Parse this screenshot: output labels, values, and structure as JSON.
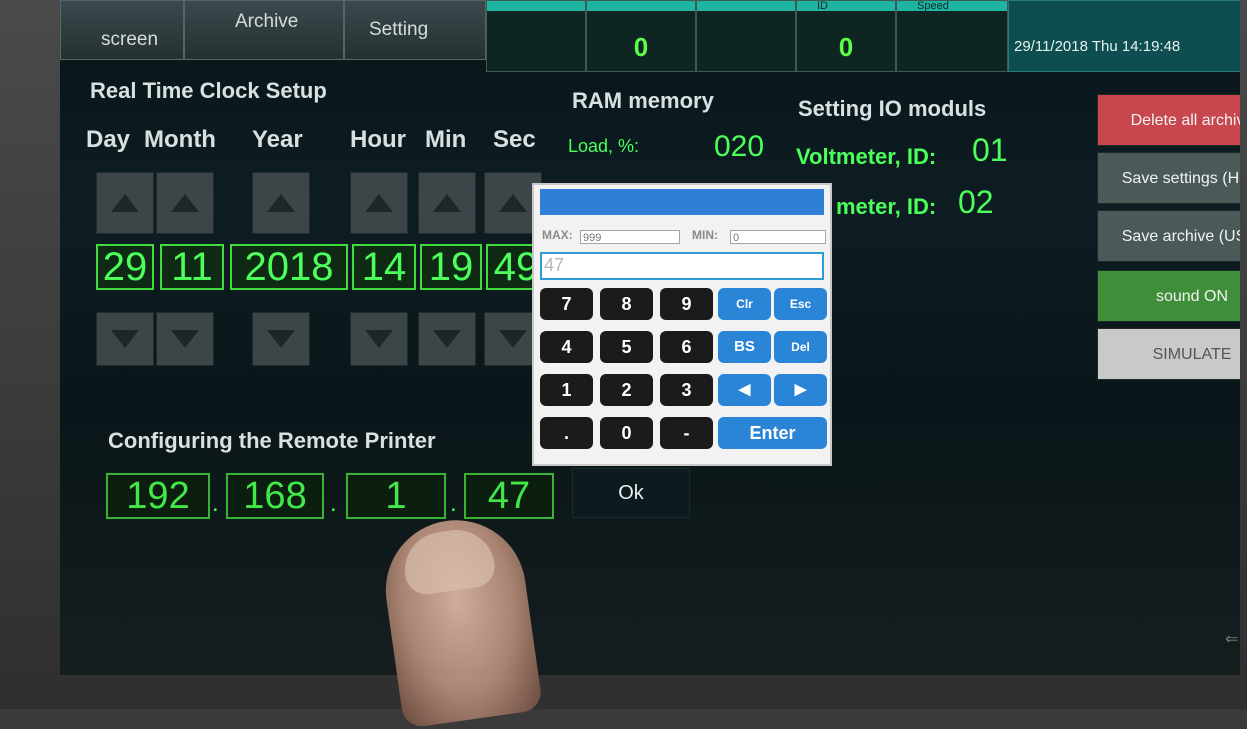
{
  "nav": {
    "screen_label": "screen",
    "archive_label": "Archive",
    "setting_label": "Setting"
  },
  "header": {
    "cells": [
      {
        "value": "0"
      },
      {
        "value": "0"
      }
    ],
    "id_label": "ID",
    "speed_label": "Speed",
    "datetime": "29/11/2018 Thu  14:19:48"
  },
  "rtc": {
    "title": "Real Time Clock Setup",
    "columns": [
      "Day",
      "Month",
      "Year",
      "Hour",
      "Min",
      "Sec"
    ],
    "values": {
      "day": "29",
      "month": "11",
      "year": "2018",
      "hour": "14",
      "min": "19",
      "sec": "49"
    }
  },
  "ram": {
    "title": "RAM memory",
    "load_label": "Load, %:",
    "load_value": "020"
  },
  "io": {
    "title": "Setting IO moduls",
    "voltmeter1_label": "Voltmeter, ID:",
    "voltmeter1_id": "01",
    "voltmeter2_label": "meter, ID:",
    "voltmeter2_id": "02"
  },
  "printer": {
    "title": "Configuring the Remote Printer",
    "ip": [
      "192",
      "168",
      "1",
      "47"
    ],
    "ok_label": "Ok"
  },
  "right_buttons": [
    {
      "label": "Delete all archive",
      "color": "#c8474f"
    },
    {
      "label": "Save settings (HMI)",
      "color": "#4a5a58"
    },
    {
      "label": "Save archive (USB)",
      "color": "#4a5a58"
    },
    {
      "label": "sound ON",
      "color": "#3f8f3a"
    },
    {
      "label": "SIMULATE",
      "color": "#c9c9c9"
    }
  ],
  "keypad": {
    "max_label": "MAX:",
    "max_value": "999",
    "min_label": "MIN:",
    "min_value": "0",
    "entry_value": "47",
    "keys": {
      "k7": "7",
      "k8": "8",
      "k9": "9",
      "clr": "Clr",
      "esc": "Esc",
      "k4": "4",
      "k5": "5",
      "k6": "6",
      "bs": "BS",
      "del": "Del",
      "k1": "1",
      "k2": "2",
      "k3": "3",
      "left": "◀",
      "right": "▶",
      "dot": ".",
      "k0": "0",
      "minus": "-",
      "enter": "Enter"
    }
  }
}
